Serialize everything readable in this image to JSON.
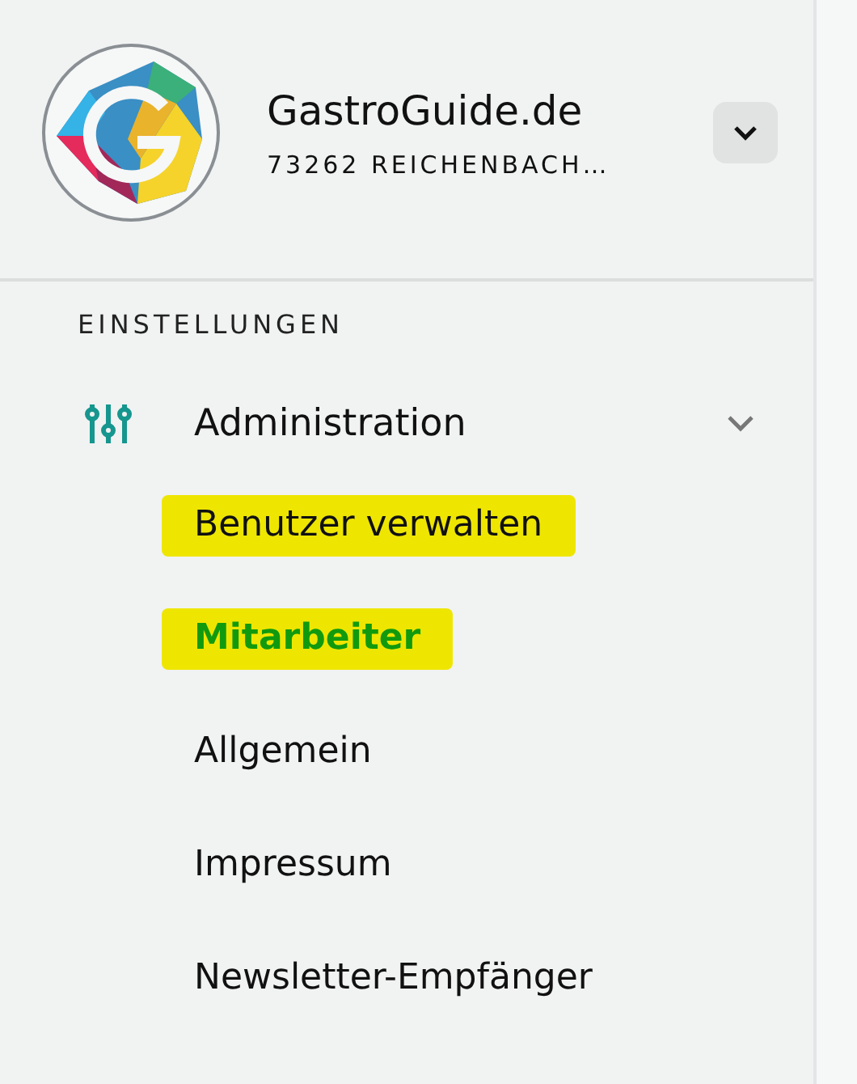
{
  "header": {
    "title": "GastroGuide.de",
    "subtitle": "73262 REICHENBACH…"
  },
  "section_label": "EINSTELLUNGEN",
  "group": {
    "label": "Administration",
    "expanded": true,
    "items": [
      {
        "label": "Benutzer verwalten",
        "selected": false,
        "highlighted": true
      },
      {
        "label": "Mitarbeiter",
        "selected": true,
        "highlighted": true
      },
      {
        "label": "Allgemein",
        "selected": false,
        "highlighted": false
      },
      {
        "label": "Impressum",
        "selected": false,
        "highlighted": false
      },
      {
        "label": "Newsletter-Empfänger",
        "selected": false,
        "highlighted": false
      }
    ]
  }
}
